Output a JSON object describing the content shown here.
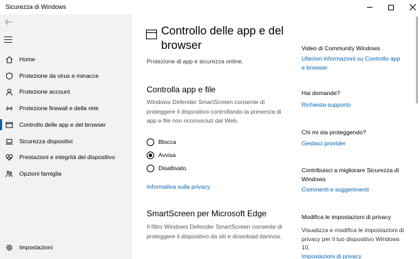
{
  "window": {
    "title": "Sicurezza di Windows"
  },
  "sidebar": {
    "items": [
      {
        "label": "Home",
        "icon": "home-icon"
      },
      {
        "label": "Protezione da virus e minacce",
        "icon": "shield-icon"
      },
      {
        "label": "Protezione account",
        "icon": "person-icon"
      },
      {
        "label": "Protezione firewall e della rete",
        "icon": "wifi-icon"
      },
      {
        "label": "Controllo delle app e del browser",
        "icon": "browser-icon",
        "active": true
      },
      {
        "label": "Sicurezza dispositivi",
        "icon": "laptop-icon"
      },
      {
        "label": "Prestazioni e integrità del dispositivo",
        "icon": "heart-icon"
      },
      {
        "label": "Opzioni famiglia",
        "icon": "family-icon"
      }
    ],
    "settings_label": "Impostazioni"
  },
  "main": {
    "title": "Controllo delle app e del browser",
    "subtitle": "Protezione di app e sicurezza online.",
    "section1": {
      "title": "Controlla app e file",
      "description": "Windows Defender SmartScreen consente di proteggere il dispositivo controllando la presenza di app e file non riconosciuti dal Web.",
      "options": [
        {
          "label": "Blocca",
          "checked": false
        },
        {
          "label": "Avvisa",
          "checked": true
        },
        {
          "label": "Disattivato",
          "checked": false
        }
      ],
      "privacy_link": "Informativa sulla privacy"
    },
    "section2": {
      "title": "SmartScreen per Microsoft Edge",
      "description": "Il filtro Windows Defender SmartScreen consente di proteggere il dispositivo da siti e download dannosi."
    }
  },
  "right": {
    "video_head": "Video di Community Windows",
    "video_link": "Ulteriori informazioni su Controllo app e browser",
    "questions_head": "Hai domande?",
    "questions_link": "Richiesta supporto",
    "protect_head": "Chi mi sta proteggendo?",
    "protect_link": "Gestisci provider",
    "contrib_head": "Contribuisci a migliorare Sicurezza di Windows",
    "contrib_link": "Commenti e suggerimenti",
    "privacy_head": "Modifica le impostazioni di privacy",
    "privacy_text": "Visualizza e modifica le impostazioni di privacy per il tuo dispositivo Windows 10.",
    "privacy_link": "Impostazioni di privacy"
  },
  "colors": {
    "accent": "#0063b1",
    "sidebar_bg": "#f2f2f2"
  }
}
